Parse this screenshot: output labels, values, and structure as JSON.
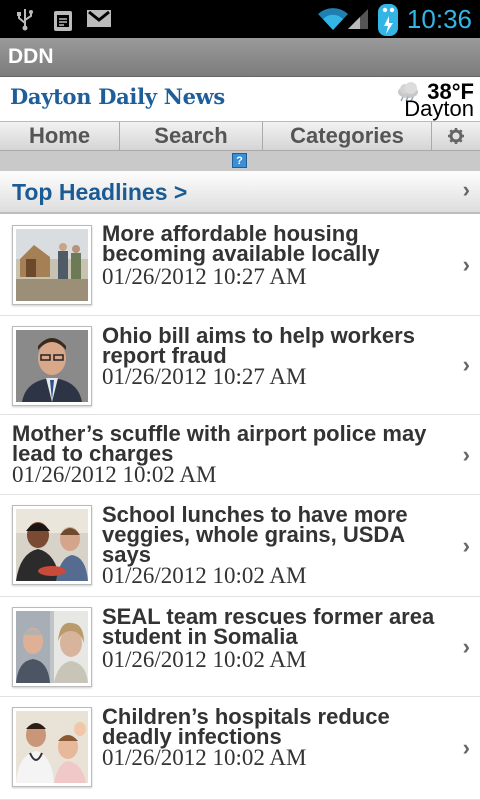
{
  "status_bar": {
    "time": "10:36",
    "icons": [
      "usb-icon",
      "android-debug-icon",
      "gmail-icon",
      "wifi-icon",
      "signal-icon",
      "battery-charging-icon"
    ]
  },
  "app_bar": {
    "title": "DDN"
  },
  "masthead": {
    "logo_text": "Dayton Daily News",
    "weather": {
      "temperature": "38°F",
      "city": "Dayton",
      "icon": "cloudy-weather-icon"
    }
  },
  "nav": {
    "home": "Home",
    "search": "Search",
    "categories": "Categories",
    "settings_icon": "gear-icon",
    "help_icon": "?"
  },
  "section": {
    "title": "Top Headlines >",
    "chevron": "›"
  },
  "articles": [
    {
      "headline": "More affordable housing becoming available locally",
      "date": "01/26/2012 10:27 AM",
      "has_thumb": true,
      "thumb": "construction-photo"
    },
    {
      "headline": "Ohio bill aims to help workers report fraud",
      "date": "01/26/2012 10:27 AM",
      "has_thumb": true,
      "thumb": "man-portrait-photo"
    },
    {
      "headline": "Mother’s scuffle with airport police may lead to charges",
      "date": "01/26/2012 10:02 AM",
      "has_thumb": false
    },
    {
      "headline": "School lunches to have more veggies, whole grains, USDA says",
      "date": "01/26/2012 10:02 AM",
      "has_thumb": true,
      "thumb": "school-lunch-photo"
    },
    {
      "headline": "SEAL team rescues former area student in Somalia",
      "date": "01/26/2012 10:02 AM",
      "has_thumb": true,
      "thumb": "two-portraits-photo"
    },
    {
      "headline": "Children’s hospitals reduce deadly infections",
      "date": "01/26/2012 10:02 AM",
      "has_thumb": true,
      "thumb": "hospital-photo"
    }
  ],
  "colors": {
    "time": "#33b5e5",
    "logo": "#1e5e9a",
    "section_title": "#1b5b94"
  }
}
